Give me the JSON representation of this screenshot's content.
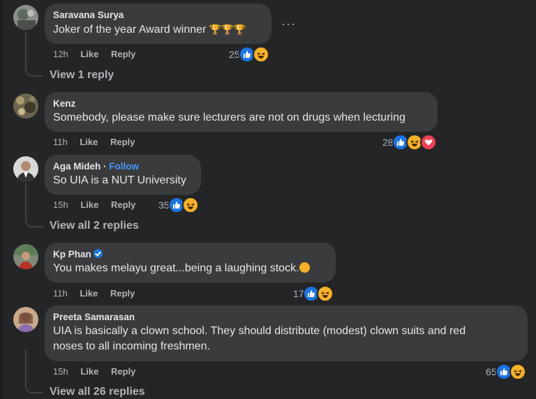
{
  "comments": [
    {
      "name": "Saravana Surya",
      "text": "Joker of the year Award winner",
      "trophies": "🏆🏆🏆",
      "time": "12h",
      "like": "Like",
      "reply": "Reply",
      "reaction_count": "25",
      "reactions": [
        "like",
        "haha"
      ],
      "view_replies": "View 1 reply"
    },
    {
      "name": "Kenz",
      "text": "Somebody, please make sure lecturers are not on drugs when lecturing",
      "time": "11h",
      "like": "Like",
      "reply": "Reply",
      "reaction_count": "28",
      "reactions": [
        "like",
        "haha",
        "love"
      ]
    },
    {
      "name": "Aga Mideh",
      "separator": "·",
      "follow": "Follow",
      "text": "So UIA is a NUT University",
      "time": "15h",
      "like": "Like",
      "reply": "Reply",
      "reaction_count": "35",
      "reactions": [
        "like",
        "haha"
      ],
      "view_replies": "View all 2 replies"
    },
    {
      "name": "Kp Phan",
      "text": "You makes melayu great...being a laughing stock.",
      "time": "11h",
      "like": "Like",
      "reply": "Reply",
      "reaction_count": "17",
      "reactions": [
        "like",
        "haha"
      ]
    },
    {
      "name": "Preeta Samarasan",
      "text_line1": "UIA is basically a clown school. They should distribute (modest) clown suits and red",
      "text_line2": "noses to all incoming freshmen.",
      "time": "15h",
      "like": "Like",
      "reply": "Reply",
      "reaction_count": "65",
      "reactions": [
        "like",
        "haha"
      ],
      "view_replies": "View all 26 replies"
    }
  ],
  "more_label": "···",
  "colors": {
    "background": "#242526",
    "bubble": "#3a3b3c",
    "like": "#1b74e4",
    "haha": "#f7b125",
    "love": "#f33e58",
    "follow": "#4599ff"
  }
}
